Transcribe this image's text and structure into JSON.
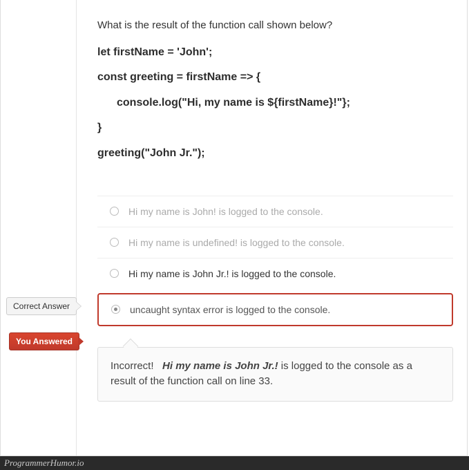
{
  "question": "What is the result of the function call shown below?",
  "code": {
    "line1": "let firstName = 'John';",
    "line2": "const greeting = firstName => {",
    "line3": "console.log(\"Hi, my name is ${firstName}!\"};",
    "line4": "}",
    "line5": "greeting(\"John Jr.\");"
  },
  "answers": {
    "a": "Hi my name is John! is logged to the console.",
    "b": "Hi my name is undefined! is logged to the console.",
    "c": "Hi my name is John Jr.! is logged to the console.",
    "d": "uncaught syntax error is logged to the console."
  },
  "tags": {
    "correct": "Correct Answer",
    "you": "You Answered"
  },
  "feedback": {
    "label": "Incorrect!",
    "bold": "Hi my name is John Jr.!",
    "rest": " is logged to the console as a result of the function call on line 33."
  },
  "watermark": "ProgrammerHumor.io"
}
